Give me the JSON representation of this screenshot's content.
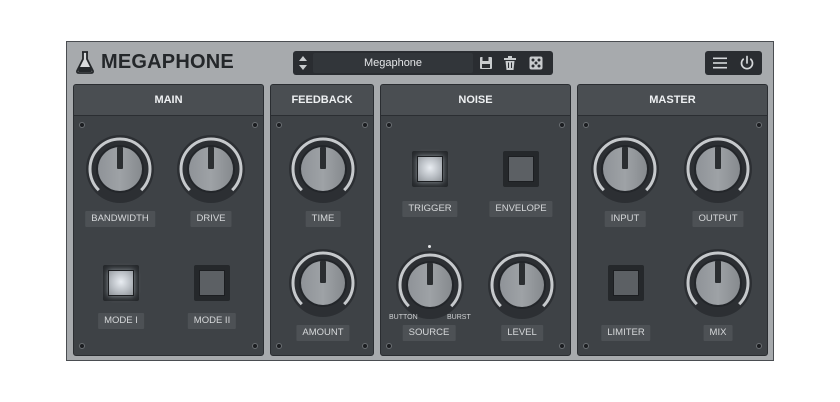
{
  "app": {
    "title": "MEGAPHONE",
    "logo_icon": "flask-icon"
  },
  "preset": {
    "name": "Megaphone"
  },
  "toolbar": {
    "arrows_icon": "up-down-arrows-icon",
    "save_icon": "save-icon",
    "delete_icon": "trash-icon",
    "random_icon": "dice-icon",
    "menu_icon": "hamburger-menu-icon",
    "power_icon": "power-icon"
  },
  "sections": {
    "main": {
      "title": "MAIN",
      "knobs": [
        {
          "label": "BANDWIDTH"
        },
        {
          "label": "DRIVE"
        }
      ],
      "buttons": [
        {
          "label": "MODE I",
          "on": true
        },
        {
          "label": "MODE II",
          "on": false
        }
      ]
    },
    "feedback": {
      "title": "FEEDBACK",
      "knobs": [
        {
          "label": "TIME"
        },
        {
          "label": "AMOUNT"
        }
      ]
    },
    "noise": {
      "title": "NOISE",
      "buttons": [
        {
          "label": "TRIGGER",
          "on": true
        },
        {
          "label": "ENVELOPE",
          "on": false
        }
      ],
      "knobs": [
        {
          "label": "SOURCE"
        },
        {
          "label": "LEVEL"
        }
      ],
      "source_min": "BUTTON",
      "source_max": "BURST"
    },
    "master": {
      "title": "MASTER",
      "knobs": [
        {
          "label": "INPUT"
        },
        {
          "label": "OUTPUT"
        },
        {
          "label": "MIX"
        }
      ],
      "buttons": [
        {
          "label": "LIMITER",
          "on": false
        }
      ]
    }
  },
  "colors": {
    "frame": "#a7aaad",
    "panel": "#3e4246",
    "knob_body": "#9ea2a6",
    "knob_ring": "#c6c9cc",
    "indicator": "#2b2e31"
  }
}
